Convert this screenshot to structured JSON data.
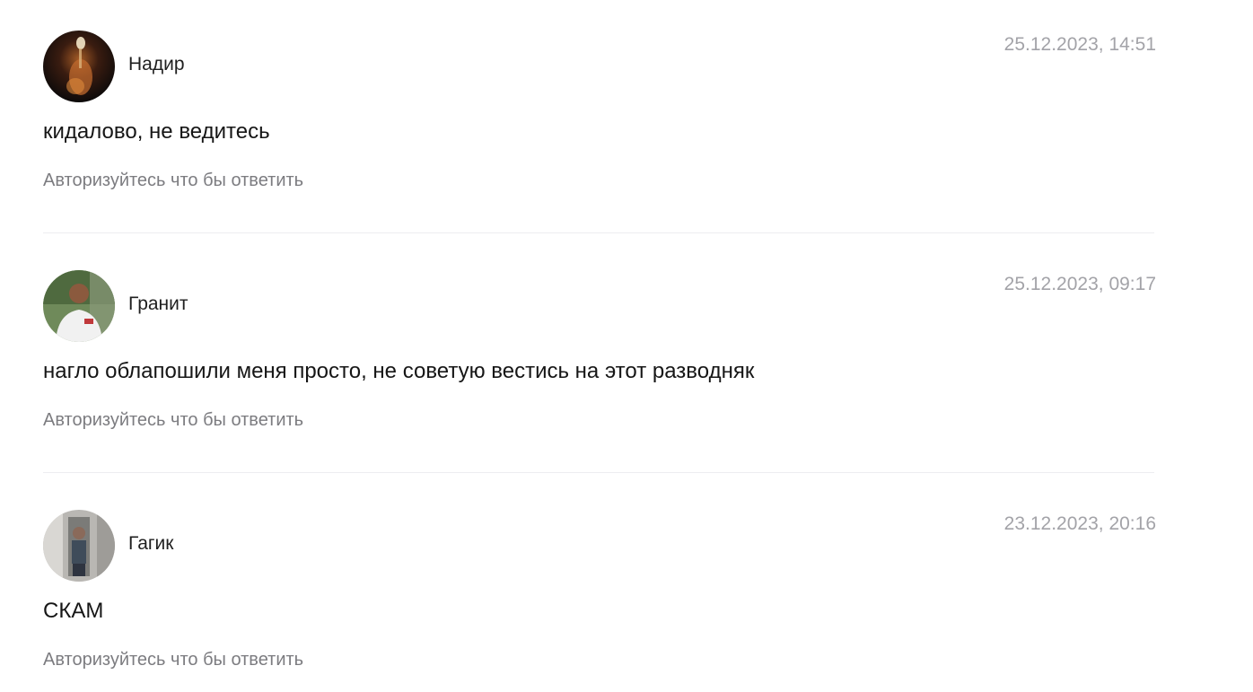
{
  "comments": [
    {
      "author": "Надир",
      "date": "25.12.2023, 14:51",
      "text": "кидалово, не ведитесь",
      "reply_label": "Авторизуйтесь что бы ответить",
      "avatar_icon": "user-photo-icon"
    },
    {
      "author": "Гранит",
      "date": "25.12.2023, 09:17",
      "text": "нагло облапошили меня просто, не советую вестись на этот разводняк",
      "reply_label": "Авторизуйтесь что бы ответить",
      "avatar_icon": "user-photo-icon"
    },
    {
      "author": "Гагик",
      "date": "23.12.2023, 20:16",
      "text": "СКАМ",
      "reply_label": "Авторизуйтесь что бы ответить",
      "avatar_icon": "user-photo-icon"
    }
  ],
  "colors": {
    "date_text": "#a3a3a8",
    "reply_text": "#7c7c80",
    "divider": "#ededf0"
  }
}
